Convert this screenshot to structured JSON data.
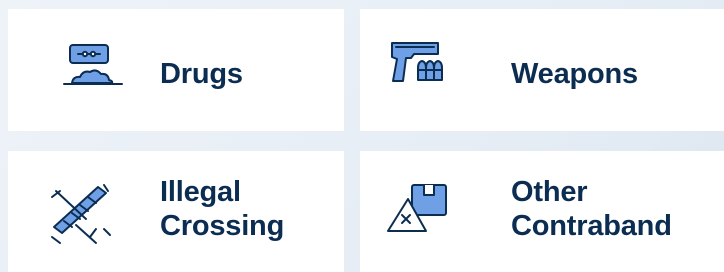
{
  "categories": [
    {
      "id": "drugs",
      "icon": "razor-blade-powder-icon",
      "lines": [
        "Drugs"
      ]
    },
    {
      "id": "weapons",
      "icon": "pistol-ammo-icon",
      "lines": [
        "Weapons"
      ]
    },
    {
      "id": "illegal-crossing",
      "icon": "barbed-wire-icon",
      "lines": [
        "Illegal",
        "Crossing"
      ]
    },
    {
      "id": "other-contraband",
      "icon": "box-x-icon",
      "lines": [
        "Other",
        "Contraband"
      ]
    }
  ],
  "colors": {
    "text": "#0c2d52",
    "icon_fill": "#6fa0e6",
    "card": "#ffffff",
    "background": "#e6edf5"
  }
}
